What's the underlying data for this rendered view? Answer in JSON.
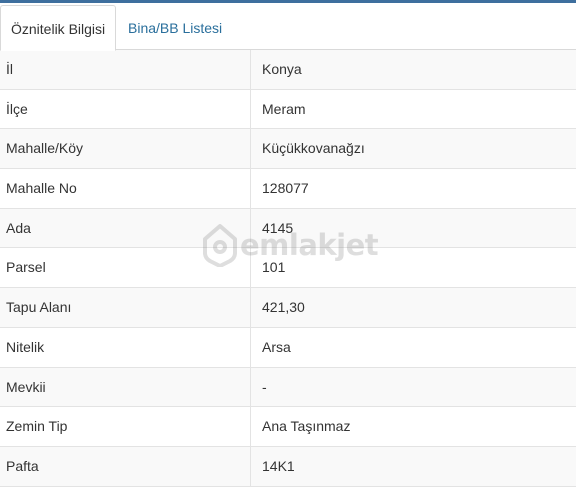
{
  "tabs": [
    {
      "label": "Öznitelik Bilgisi",
      "active": true
    },
    {
      "label": "Bina/BB Listesi",
      "active": false
    }
  ],
  "rows": [
    {
      "key": "İl",
      "value": "Konya"
    },
    {
      "key": "İlçe",
      "value": "Meram"
    },
    {
      "key": "Mahalle/Köy",
      "value": "Küçükkovanağzı"
    },
    {
      "key": "Mahalle No",
      "value": "128077"
    },
    {
      "key": "Ada",
      "value": "4145"
    },
    {
      "key": "Parsel",
      "value": "101"
    },
    {
      "key": "Tapu Alanı",
      "value": "421,30"
    },
    {
      "key": "Nitelik",
      "value": "Arsa"
    },
    {
      "key": "Mevkii",
      "value": "-"
    },
    {
      "key": "Zemin Tip",
      "value": "Ana Taşınmaz"
    },
    {
      "key": "Pafta",
      "value": "14K1"
    }
  ],
  "watermark": {
    "text": "emlakjet",
    "icon": "house-pin-icon"
  },
  "colors": {
    "accent_bar": "#3e6f9e",
    "tab_link": "#2a6f9c",
    "text": "#333333",
    "border": "#e3e3e3",
    "row_stripe": "#f9f9f9"
  }
}
